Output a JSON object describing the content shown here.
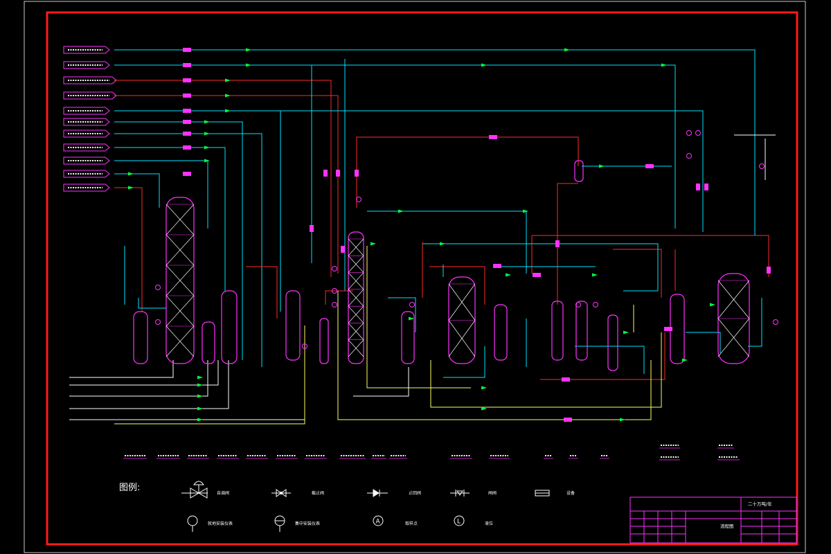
{
  "legend": {
    "title": "图例:",
    "items": [
      {
        "label": "自调阀"
      },
      {
        "label": "截止阀"
      },
      {
        "label": "止回阀"
      },
      {
        "label": "闸阀"
      },
      {
        "label": "设备"
      },
      {
        "label": "就地安装仪表"
      },
      {
        "label": "集中安装仪表"
      },
      {
        "label": "取样点"
      },
      {
        "label": "液位"
      }
    ]
  },
  "title_block": {
    "project": "二十万吨/年",
    "drawing": "流程图"
  },
  "colors": {
    "border": "#ff1a1a",
    "line_steam": "#ff2a2a",
    "line_water": "#00e5ff",
    "line_process": "#ffff66",
    "line_utility": "#ffffff",
    "equipment": "#ff33ff",
    "valve": "#ff33ff",
    "flow_arrow": "#00ff44"
  }
}
